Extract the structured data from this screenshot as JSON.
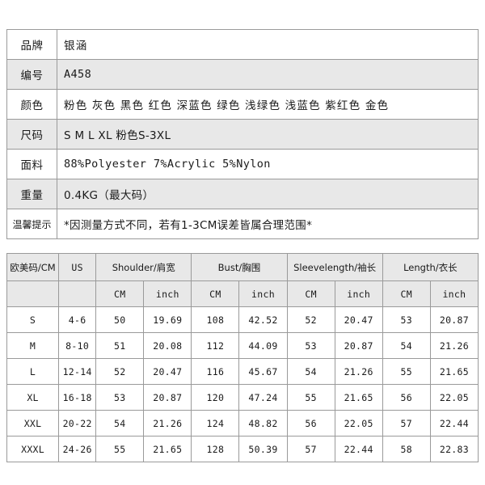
{
  "info": {
    "rows": [
      {
        "key": "品牌",
        "value": "银涵",
        "style": "cjk",
        "alt": false,
        "name": "brand"
      },
      {
        "key": "编号",
        "value": "A458",
        "style": "mono",
        "alt": true,
        "name": "model-number"
      },
      {
        "key": "颜色",
        "value": "粉色 灰色 黑色 红色 深蓝色 绿色 浅绿色 浅蓝色 紫红色 金色",
        "style": "cjk",
        "alt": false,
        "name": "colors"
      },
      {
        "key": "尺码",
        "value": "S M L XL  粉色S-3XL",
        "style": "mix",
        "alt": true,
        "name": "sizes"
      },
      {
        "key": "面料",
        "value": "88%Polyester  7%Acrylic  5%Nylon",
        "style": "mono",
        "alt": false,
        "name": "fabric"
      },
      {
        "key": "重量",
        "value": "0.4KG（最大码）",
        "style": "mix",
        "alt": true,
        "name": "weight"
      },
      {
        "key": "温馨提示",
        "value": "*因测量方式不同，若有1-3CM误差皆属合理范围*",
        "style": "mix",
        "alt": false,
        "name": "notice"
      }
    ],
    "color_list": [
      "粉色",
      "灰色",
      "黑色",
      "红色",
      "深蓝色",
      "绿色",
      "浅绿色",
      "浅蓝色",
      "紫红色",
      "金色"
    ],
    "size_list": [
      "S",
      "M",
      "L",
      "XL"
    ],
    "pink_size_range": "粉色S-3XL",
    "fabric_composition": [
      {
        "percent": "88%",
        "material": "Polyester"
      },
      {
        "percent": "7%",
        "material": "Acrylic"
      },
      {
        "percent": "5%",
        "material": "Nylon"
      }
    ],
    "weight_value": "0.4KG",
    "weight_qualifier": "最大码"
  },
  "size_chart": {
    "group_headers": [
      {
        "label": "欧美码/CM",
        "span": 1,
        "colclass": "col-eu",
        "cjk": true,
        "name": "header-eu-size"
      },
      {
        "label": "US",
        "span": 1,
        "colclass": "col-us",
        "cjk": false,
        "name": "header-us-size"
      },
      {
        "label": "Shoulder/肩宽",
        "span": 2,
        "colclass": "col-meas",
        "cjk": true,
        "name": "header-shoulder"
      },
      {
        "label": "Bust/胸围",
        "span": 2,
        "colclass": "col-meas",
        "cjk": true,
        "name": "header-bust"
      },
      {
        "label": "Sleevelength/袖长",
        "span": 2,
        "colclass": "col-meas",
        "cjk": true,
        "name": "header-sleeve"
      },
      {
        "label": "Length/衣长",
        "span": 2,
        "colclass": "col-meas",
        "cjk": true,
        "name": "header-length"
      }
    ],
    "unit_headers": [
      "",
      "",
      "CM",
      "inch",
      "CM",
      "inch",
      "CM",
      "inch",
      "CM",
      "inch"
    ],
    "rows": [
      {
        "eu": "S",
        "us": "4-6",
        "shoulder_cm": "50",
        "shoulder_in": "19.69",
        "bust_cm": "108",
        "bust_in": "42.52",
        "sleeve_cm": "52",
        "sleeve_in": "20.47",
        "length_cm": "53",
        "length_in": "20.87"
      },
      {
        "eu": "M",
        "us": "8-10",
        "shoulder_cm": "51",
        "shoulder_in": "20.08",
        "bust_cm": "112",
        "bust_in": "44.09",
        "sleeve_cm": "53",
        "sleeve_in": "20.87",
        "length_cm": "54",
        "length_in": "21.26"
      },
      {
        "eu": "L",
        "us": "12-14",
        "shoulder_cm": "52",
        "shoulder_in": "20.47",
        "bust_cm": "116",
        "bust_in": "45.67",
        "sleeve_cm": "54",
        "sleeve_in": "21.26",
        "length_cm": "55",
        "length_in": "21.65"
      },
      {
        "eu": "XL",
        "us": "16-18",
        "shoulder_cm": "53",
        "shoulder_in": "20.87",
        "bust_cm": "120",
        "bust_in": "47.24",
        "sleeve_cm": "55",
        "sleeve_in": "21.65",
        "length_cm": "56",
        "length_in": "22.05"
      },
      {
        "eu": "XXL",
        "us": "20-22",
        "shoulder_cm": "54",
        "shoulder_in": "21.26",
        "bust_cm": "124",
        "bust_in": "48.82",
        "sleeve_cm": "56",
        "sleeve_in": "22.05",
        "length_cm": "57",
        "length_in": "22.44"
      },
      {
        "eu": "XXXL",
        "us": "24-26",
        "shoulder_cm": "55",
        "shoulder_in": "21.65",
        "bust_cm": "128",
        "bust_in": "50.39",
        "sleeve_cm": "57",
        "sleeve_in": "22.44",
        "length_cm": "58",
        "length_in": "22.83"
      }
    ]
  },
  "colors": {
    "border": "#9a9a9a",
    "stripe": "#e8e8e8",
    "background": "#ffffff",
    "text": "#1a1a1a"
  }
}
